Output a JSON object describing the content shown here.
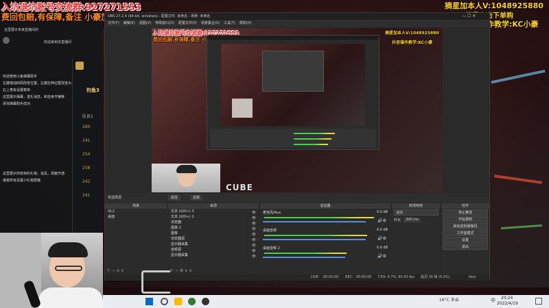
{
  "overlay": {
    "top_left_line1": "入坑退坑账号交流群:927271553",
    "top_left_line2": "费回包赔,有保障,备注 小豪加入",
    "top_right_line1": "摘星加本人V:1048925880",
    "top_right_line2": "摘星点击下单购",
    "top_right_line3": "抖音操作教学:KC小豪"
  },
  "chat": {
    "items": [
      "这里展示未来直播间的",
      "欢迎来到本直播间",
      "欢迎使用斗鱼弹幕助手",
      "左键拖动四周改变位置，左键拉伸边框改变大小",
      "右上角有设置菜单",
      "这里展示弹幕，送礼消息，和自身开播等",
      "添加弹幕助手成功",
      "这里展示你收到的礼物，道具，贡献开通",
      "或者所有设置小礼物屏蔽"
    ],
    "list_label": "队员1",
    "list_values": [
      "260",
      "241",
      "254",
      "258",
      "242",
      "241"
    ],
    "name_tag": "钓鱼3"
  },
  "obs": {
    "title": "OBS 27.2.4 (64-bit, windows) - 配置文件: 未命名 - 场景: 未命名",
    "menu": [
      "文件(F)",
      "编辑(E)",
      "视图(V)",
      "停靠窗口(D)",
      "配置文件(P)",
      "场景集合(S)",
      "工具(T)",
      "帮助(H)"
    ],
    "no_source_label": "未选择源",
    "props_label": "属性",
    "filters_label": "滤镜",
    "panels": {
      "scenes": "场景",
      "sources": "来源",
      "mixer": "混音器",
      "transitions": "转场特效",
      "controls": "控件"
    },
    "scenes": [
      "OL2",
      "桌面"
    ],
    "sources": [
      "文本 (GDI+) 3",
      "文本 (GDI+) 2",
      "浏览器",
      "图像 2",
      "图像",
      "浏览器源",
      "显示器采集",
      "音频源",
      "显示器采集"
    ],
    "mixer": [
      {
        "name": "麦克风/Aux",
        "level": "0.0 dB",
        "fill": 0.85
      },
      {
        "name": "桌面音频",
        "level": "0.0 dB",
        "fill": 0.78
      },
      {
        "name": "桌面音频 2",
        "level": "0.0 dB",
        "fill": 0.62
      }
    ],
    "transition": {
      "type": "淡出",
      "duration_label": "时长",
      "duration": "300 ms"
    },
    "controls": [
      "停止推流",
      "开始录制",
      "启动虚拟摄像机",
      "工作室模式",
      "设置",
      "退出"
    ],
    "status": {
      "live_label": "LIVE:",
      "live_time": "00:00:00",
      "rec_label": "REC:",
      "rec_time": "00:00:00",
      "cpu": "CPU: 4.7%, 60.00 fps",
      "dropped": "延迟 16 帧 (0.0%)",
      "kbps": "kb/s"
    }
  },
  "taskbar": {
    "weather": "16°C 多云",
    "time": "20:24",
    "date": "2022/4/19",
    "ime": "中"
  },
  "logo_text": "CUBE"
}
